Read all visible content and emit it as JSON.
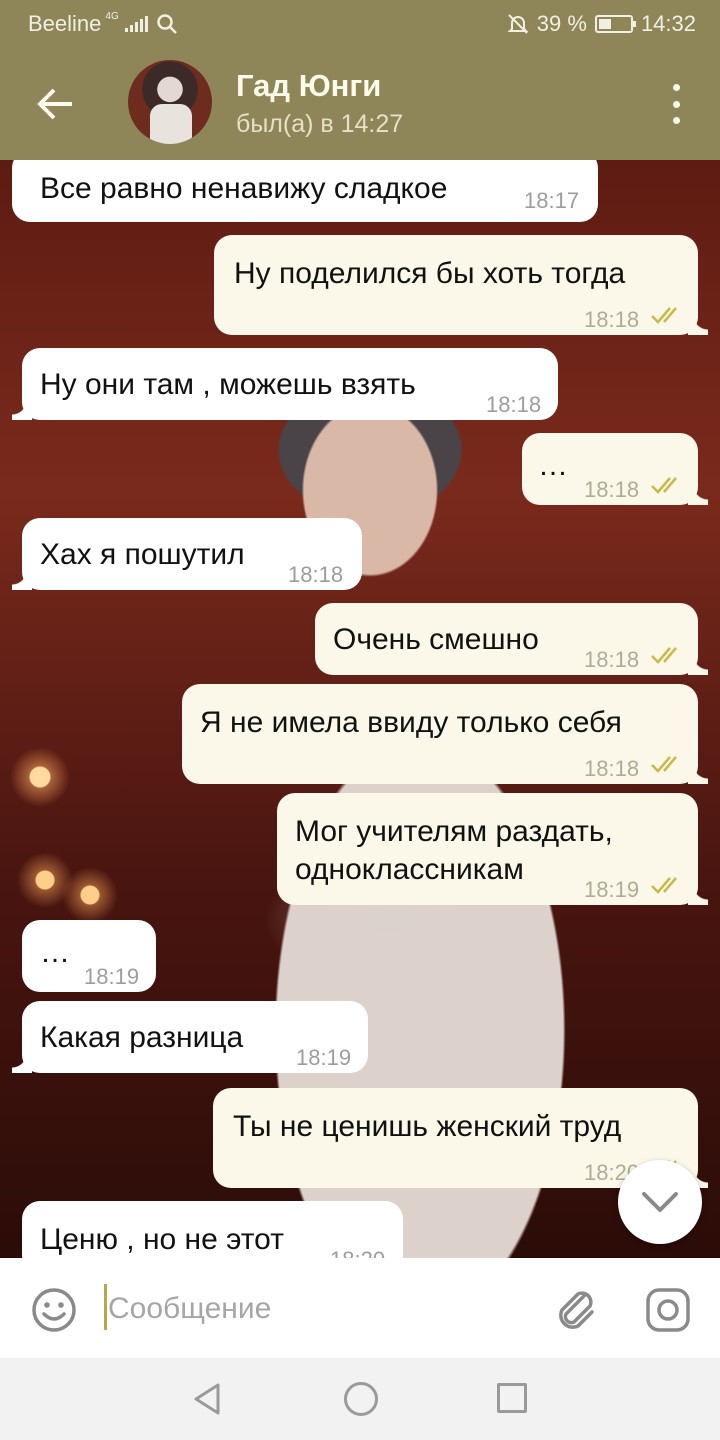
{
  "status_bar": {
    "carrier": "Beeline",
    "network": "4G",
    "battery_text": "39 %",
    "battery_level": 0.39,
    "time": "14:32"
  },
  "header": {
    "contact_name": "Гад Юнги",
    "last_seen": "был(а) в 14:27"
  },
  "messages": [
    {
      "dir": "in",
      "text": "Все равно ненавижу сладкое",
      "time": "18:17"
    },
    {
      "dir": "out",
      "text": "Ну поделился бы хоть тогда",
      "time": "18:18"
    },
    {
      "dir": "in",
      "text": "Ну они там , можешь взять",
      "time": "18:18"
    },
    {
      "dir": "out",
      "text": "…",
      "time": "18:18"
    },
    {
      "dir": "in",
      "text": "Хах я пошутил",
      "time": "18:18"
    },
    {
      "dir": "out",
      "text": "Очень смешно",
      "time": "18:18"
    },
    {
      "dir": "out",
      "text": "Я не имела ввиду только себя",
      "time": "18:18"
    },
    {
      "dir": "out",
      "text_line1": "Мог учителям раздать,",
      "text_line2": "одноклассникам",
      "time": "18:19"
    },
    {
      "dir": "in",
      "text": "…",
      "time": "18:19"
    },
    {
      "dir": "in",
      "text": "Какая разница",
      "time": "18:19"
    },
    {
      "dir": "out",
      "text": "Ты не ценишь женский труд",
      "time": "18:20"
    },
    {
      "dir": "in",
      "text": "Ценю , но не этот",
      "time": "18:20"
    }
  ],
  "composer": {
    "placeholder": "Сообщение"
  },
  "icons": {
    "back": "arrow-left-icon",
    "menu": "more-vertical-icon",
    "emoji": "smiley-icon",
    "attach": "paperclip-icon",
    "camera": "camera-icon",
    "scroll": "chevron-down-icon",
    "read": "double-check-icon"
  },
  "colors": {
    "header_bg": "#8e8659",
    "incoming_bubble": "#ffffff",
    "outgoing_bubble": "#fbf8ea",
    "read_ticks": "#c9b84a"
  }
}
